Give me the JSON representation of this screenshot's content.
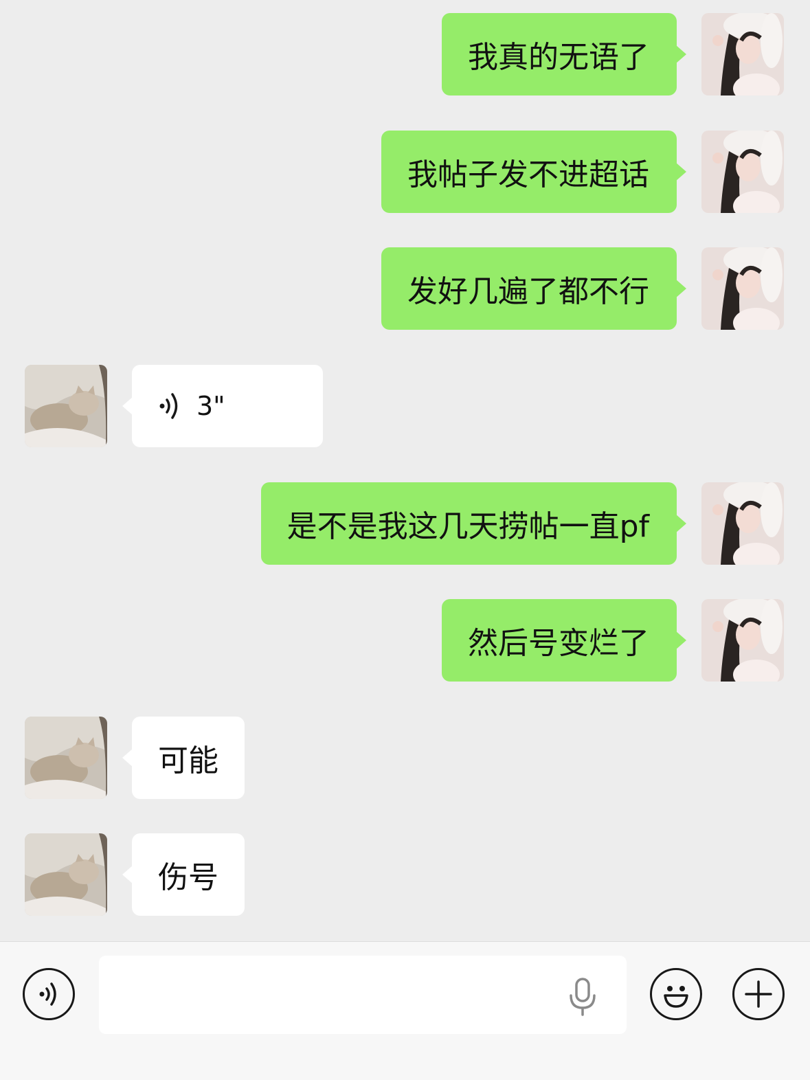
{
  "messages": [
    {
      "side": "right",
      "type": "text",
      "text": "我真的无语了",
      "avatar": "girl-avatar"
    },
    {
      "side": "right",
      "type": "text",
      "text": "我帖子发不进超话",
      "avatar": "girl-avatar"
    },
    {
      "side": "right",
      "type": "text",
      "text": "发好几遍了都不行",
      "avatar": "girl-avatar"
    },
    {
      "side": "left",
      "type": "voice",
      "duration": "3\"",
      "avatar": "cat-avatar"
    },
    {
      "side": "right",
      "type": "text",
      "text": "是不是我这几天捞帖一直pf",
      "avatar": "girl-avatar"
    },
    {
      "side": "right",
      "type": "text",
      "text": "然后号变烂了",
      "avatar": "girl-avatar"
    },
    {
      "side": "left",
      "type": "text",
      "text": "可能",
      "avatar": "cat-avatar"
    },
    {
      "side": "left",
      "type": "text",
      "text": "伤号",
      "avatar": "cat-avatar"
    }
  ],
  "input_bar": {
    "placeholder": "",
    "left_icon": "voice-mode-icon",
    "mic_icon": "microphone-icon",
    "emoji_icon": "emoji-icon",
    "plus_icon": "plus-icon"
  },
  "colors": {
    "background": "#ededed",
    "sent_bubble": "#95ec69",
    "received_bubble": "#ffffff",
    "input_bar": "#f7f7f7"
  }
}
